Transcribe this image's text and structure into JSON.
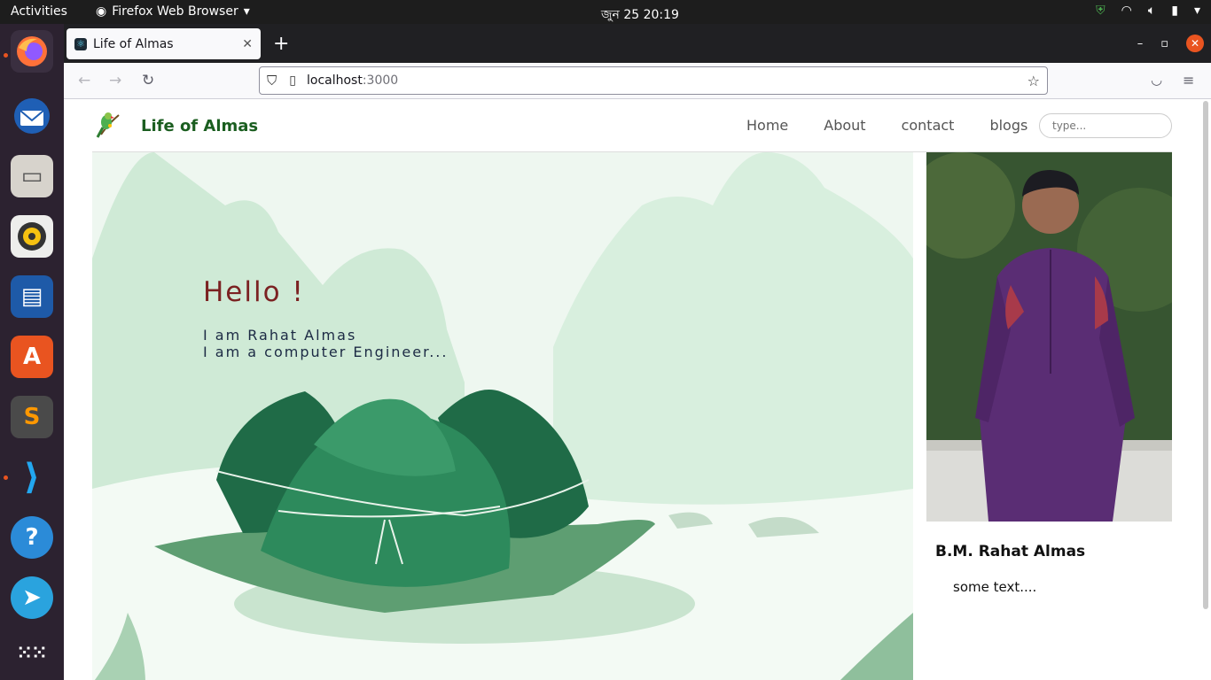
{
  "system": {
    "activities": "Activities",
    "app_name": "Firefox Web Browser",
    "clock": "জুন 25  20:19"
  },
  "browser": {
    "tab_title": "Life of Almas",
    "url_host": "localhost",
    "url_port": ":3000"
  },
  "site": {
    "brand": "Life of Almas",
    "nav": [
      "Home",
      "About",
      "contact",
      "blogs"
    ],
    "search_placeholder": "type...",
    "hero": {
      "greeting": "Hello !",
      "line1": "I am Rahat Almas",
      "line2": "I am a computer Engineer..."
    },
    "profile": {
      "name": "B.M. Rahat Almas",
      "text": "some text...."
    }
  },
  "colors": {
    "accent": "#e95420",
    "brand_green": "#1b5e20",
    "greeting": "#7b2222"
  }
}
